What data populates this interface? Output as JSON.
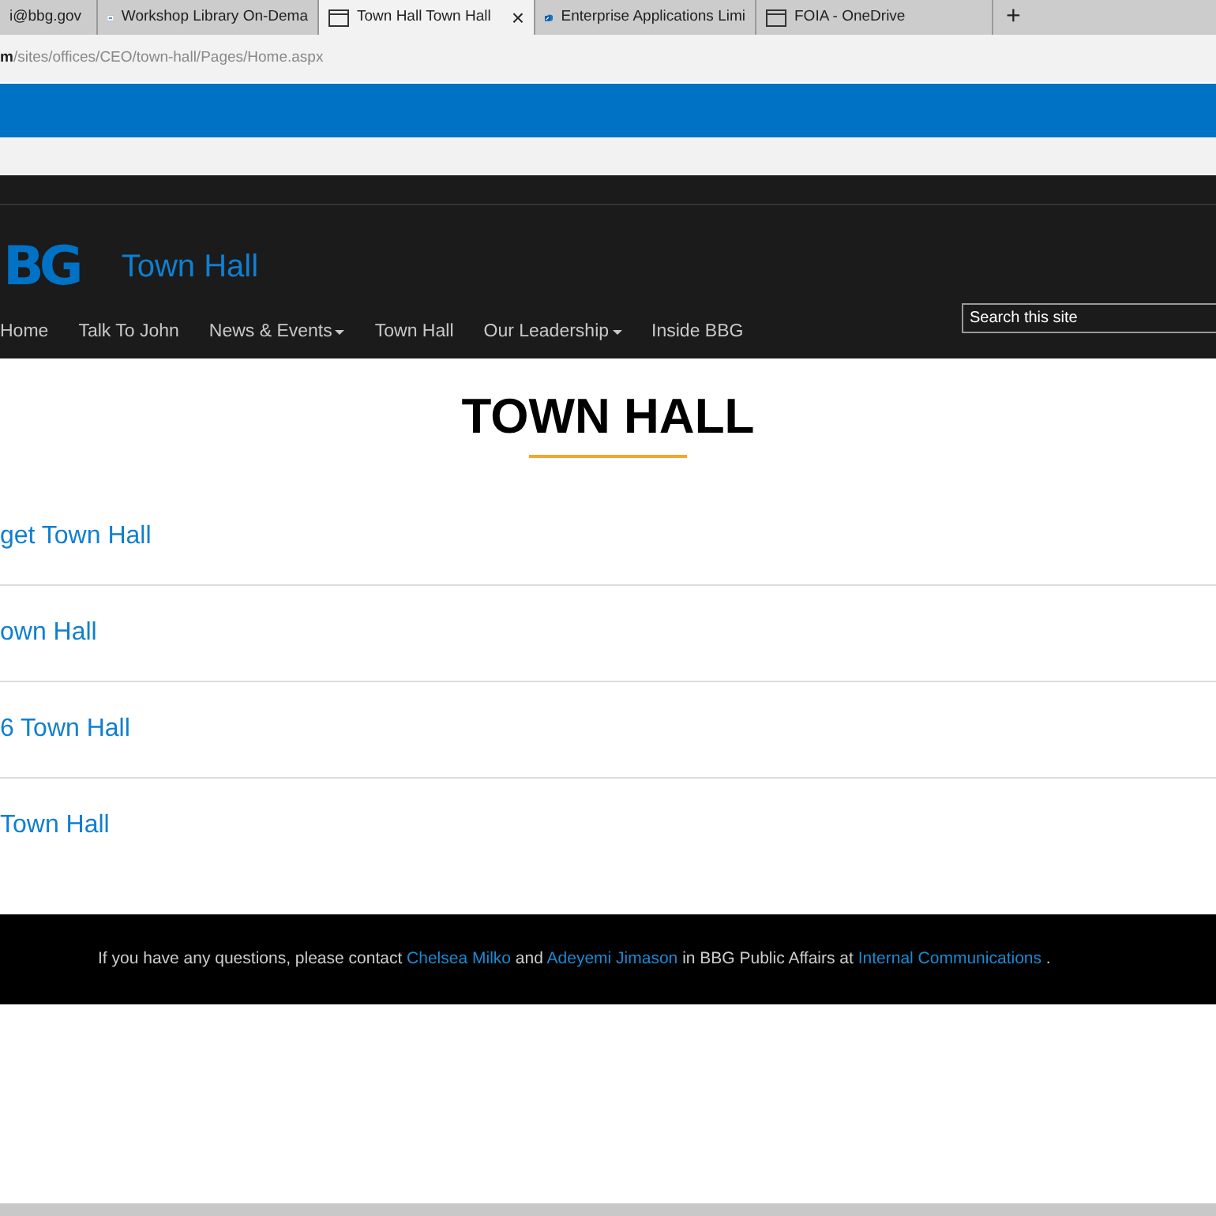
{
  "browser": {
    "tabs": [
      {
        "label": "i@bbg.gov",
        "selected": false
      },
      {
        "label": "Workshop Library On-Dema",
        "selected": false
      },
      {
        "label": "Town Hall Town Hall",
        "selected": true,
        "close": "×"
      },
      {
        "label": "Enterprise Applications Limi",
        "selected": false
      },
      {
        "label": "FOIA - OneDrive",
        "selected": false
      }
    ],
    "new_tab": "+",
    "address": "**m**/sites/offices/CEO/town-hall/Pages/Home.aspx"
  },
  "site": {
    "logo_text": "BG",
    "title": "Town Hall",
    "nav": [
      {
        "label": "Home",
        "dropdown": false
      },
      {
        "label": "Talk To John",
        "dropdown": false
      },
      {
        "label": "News & Events",
        "dropdown": true
      },
      {
        "label": "Town Hall",
        "dropdown": false
      },
      {
        "label": "Our Leadership",
        "dropdown": true
      },
      {
        "label": "Inside BBG",
        "dropdown": false
      }
    ],
    "search": {
      "placeholder": "Search this site"
    }
  },
  "page": {
    "heading": "TOWN HALL",
    "links": [
      "get Town Hall",
      "own Hall",
      "6 Town Hall",
      "Town Hall"
    ]
  },
  "footer": [
    {
      "kind": "text",
      "text": "If you have any questions, please contact "
    },
    {
      "kind": "link",
      "text": "Chelsea Milko"
    },
    {
      "kind": "text",
      "text": " and "
    },
    {
      "kind": "link",
      "text": "Adeyemi Jimason"
    },
    {
      "kind": "text",
      "text": " in BBG Public Affairs at "
    },
    {
      "kind": "link",
      "text": "Internal Communications"
    },
    {
      "kind": "text",
      "text": " ."
    }
  ]
}
